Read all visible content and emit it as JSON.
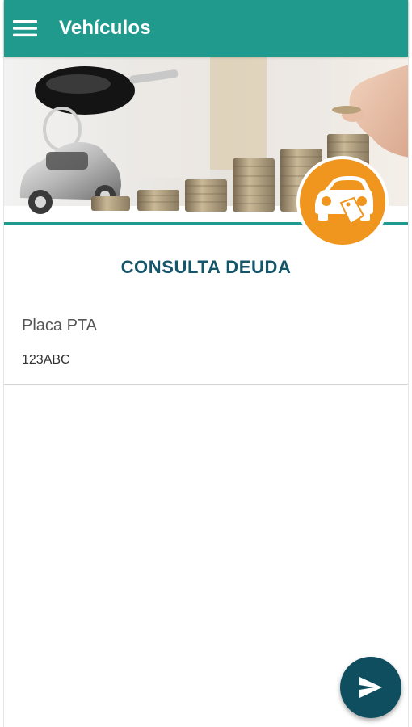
{
  "app_bar": {
    "title": "Vehículos",
    "menu_icon": "hamburger-menu-icon",
    "background": "#1f9a8c"
  },
  "banner": {
    "image": "car-keys-and-coin-stacks-photo",
    "badge_icon": "car-with-price-tag-icon",
    "badge_color": "#f0961e"
  },
  "form": {
    "title": "CONSULTA DEUDA",
    "plate_label": "Placa PTA",
    "plate_value": "123ABC"
  },
  "fab": {
    "icon": "send-icon",
    "color": "#0f4e5f"
  }
}
